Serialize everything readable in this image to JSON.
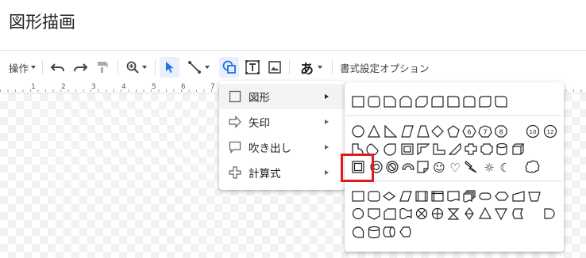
{
  "title": "図形描画",
  "toolbar": {
    "actions_label": "操作",
    "format_options_label": "書式設定オプション",
    "text_style_glyph": "あ"
  },
  "ruler": {
    "numbers": [
      "1",
      "2",
      "3",
      "4",
      "5",
      "6",
      "7"
    ]
  },
  "shape_menu": {
    "items": [
      {
        "label": "図形",
        "icon": "square-icon"
      },
      {
        "label": "矢印",
        "icon": "arrow-icon"
      },
      {
        "label": "吹き出し",
        "icon": "callout-icon"
      },
      {
        "label": "計算式",
        "icon": "plus-icon"
      }
    ]
  },
  "shape_glyphs": {
    "hexagon": "6",
    "heptagon": "7",
    "octagon": "8",
    "decagon": "10",
    "dodecagon": "12",
    "smiley": "☺",
    "heart": "♡",
    "sun": "☼",
    "moon": "☾"
  },
  "colors": {
    "accent": "#1a73e8",
    "highlight_frame": "#e21b1b"
  }
}
